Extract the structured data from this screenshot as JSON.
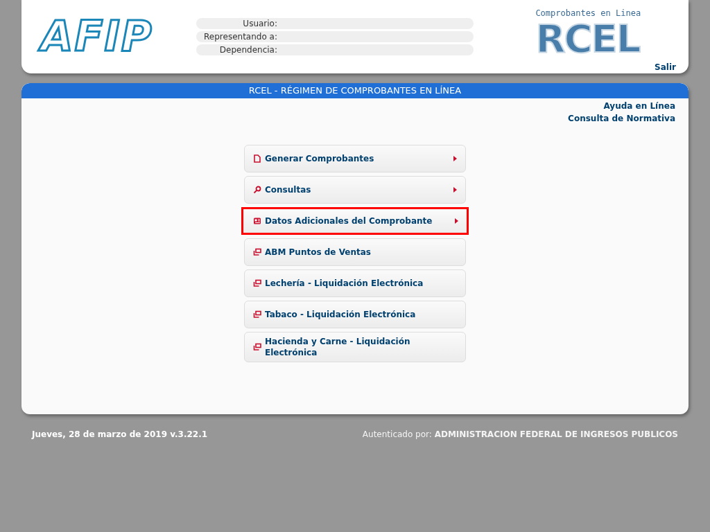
{
  "header": {
    "logo": "AFIP",
    "user_fields": [
      {
        "label": "Usuario:"
      },
      {
        "label": "Representando a:"
      },
      {
        "label": "Dependencia:"
      }
    ],
    "rcel_logo": {
      "caption": "Comprobantes en Linea",
      "mark": "RCEL"
    },
    "logout": "Salir"
  },
  "main": {
    "title": "RCEL - RÉGIMEN DE COMPROBANTES EN LÍNEA",
    "links": [
      "Ayuda en Línea",
      "Consulta de Normativa"
    ],
    "menu": [
      {
        "kind": "document",
        "label": "Generar Comprobantes",
        "has_submenu": true,
        "highlighted": false
      },
      {
        "kind": "search",
        "label": "Consultas",
        "has_submenu": true,
        "highlighted": false
      },
      {
        "kind": "form",
        "label": "Datos Adicionales del Comprobante",
        "has_submenu": true,
        "highlighted": true
      },
      {
        "kind": "external",
        "label": "ABM Puntos de Ventas",
        "has_submenu": false,
        "highlighted": false
      },
      {
        "kind": "external",
        "label": "Lechería - Liquidación Electrónica",
        "has_submenu": false,
        "highlighted": false
      },
      {
        "kind": "external",
        "label": "Tabaco - Liquidación Electrónica",
        "has_submenu": false,
        "highlighted": false
      },
      {
        "kind": "external",
        "label": "Hacienda y Carne - Liquidación Electrónica",
        "has_submenu": false,
        "highlighted": false
      }
    ]
  },
  "footer": {
    "date": "Jueves, 28 de marzo de 2019 v.3.22.1",
    "auth": "Autenticado por: **ADMINISTRACION FEDERAL DE INGRESOS PUBLICOS**"
  }
}
